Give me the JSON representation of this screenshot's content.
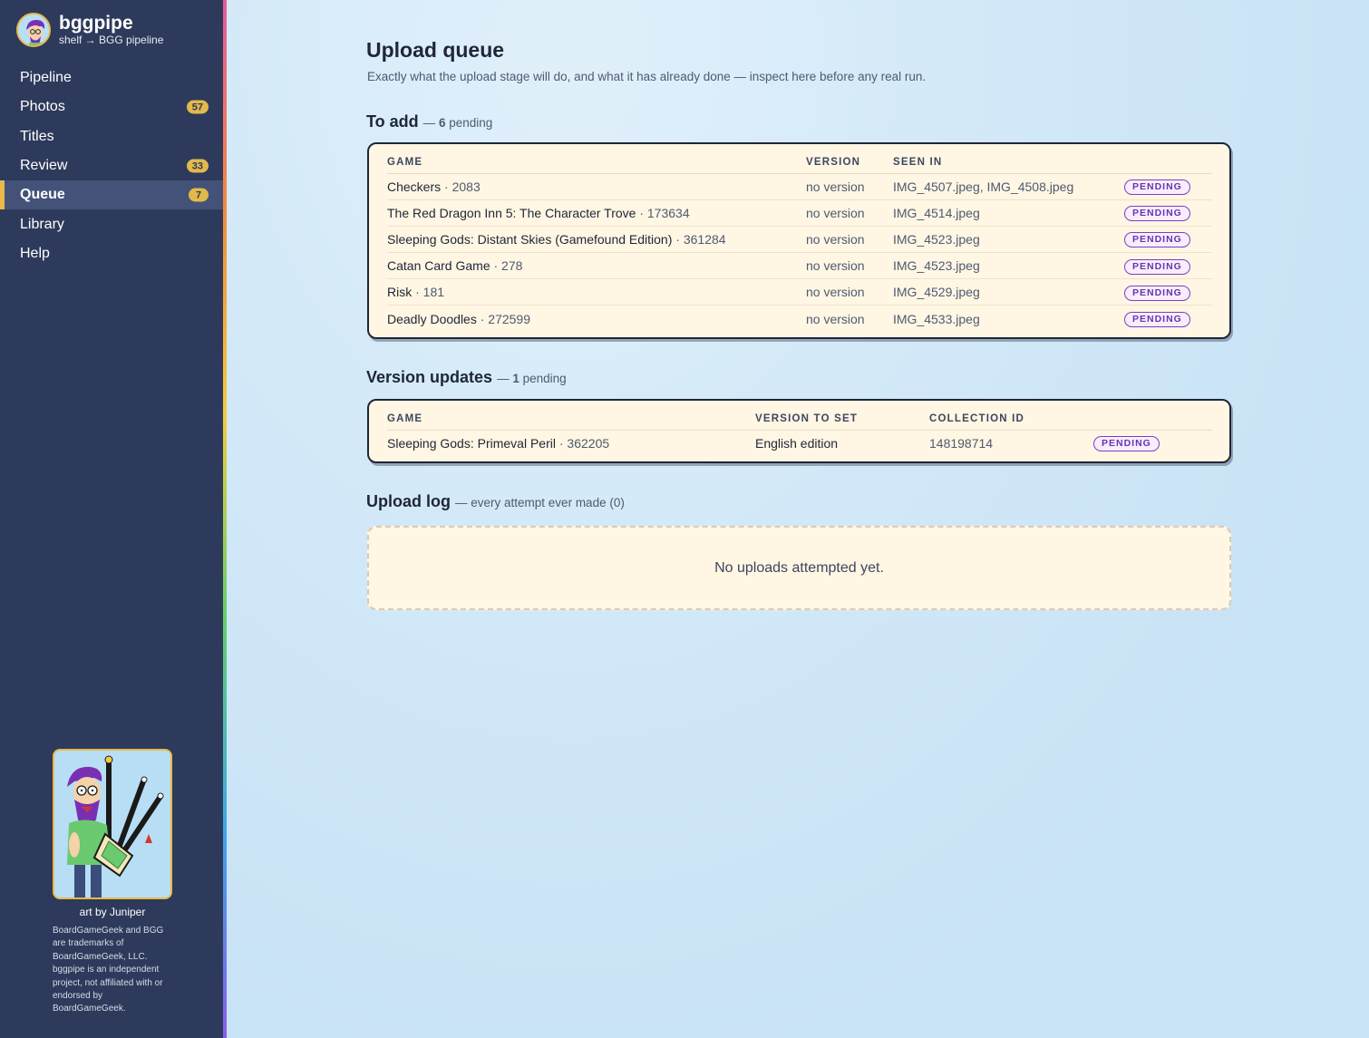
{
  "app": {
    "name": "bggpipe",
    "tagline": "shelf → BGG pipeline"
  },
  "nav": {
    "items": [
      {
        "label": "Pipeline",
        "badge": null
      },
      {
        "label": "Photos",
        "badge": "57"
      },
      {
        "label": "Titles",
        "badge": null
      },
      {
        "label": "Review",
        "badge": "33"
      },
      {
        "label": "Queue",
        "badge": "7",
        "active": true
      },
      {
        "label": "Library",
        "badge": null
      },
      {
        "label": "Help",
        "badge": null
      }
    ]
  },
  "sidebar_footer": {
    "art_credit": "art by Juniper",
    "disclaimer": "BoardGameGeek and BGG are trademarks of BoardGameGeek, LLC. bggpipe is an independent project, not affiliated with or endorsed by BoardGameGeek."
  },
  "page": {
    "title": "Upload queue",
    "subtitle": "Exactly what the upload stage will do, and what it has already done — inspect here before any real run."
  },
  "to_add": {
    "title": "To add",
    "dash": "—",
    "count": "6",
    "count_suffix": "pending",
    "columns": [
      "GAME",
      "VERSION",
      "SEEN IN",
      ""
    ],
    "rows": [
      {
        "game": "Checkers",
        "id": "· 2083",
        "version": "no version",
        "seen_in": "IMG_4507.jpeg, IMG_4508.jpeg",
        "status": "PENDING"
      },
      {
        "game": "The Red Dragon Inn 5: The Character Trove",
        "id": "· 173634",
        "version": "no version",
        "seen_in": "IMG_4514.jpeg",
        "status": "PENDING"
      },
      {
        "game": "Sleeping Gods: Distant Skies (Gamefound Edition)",
        "id": "· 361284",
        "version": "no version",
        "seen_in": "IMG_4523.jpeg",
        "status": "PENDING"
      },
      {
        "game": "Catan Card Game",
        "id": "· 278",
        "version": "no version",
        "seen_in": "IMG_4523.jpeg",
        "status": "PENDING"
      },
      {
        "game": "Risk",
        "id": "· 181",
        "version": "no version",
        "seen_in": "IMG_4529.jpeg",
        "status": "PENDING"
      },
      {
        "game": "Deadly Doodles",
        "id": "· 272599",
        "version": "no version",
        "seen_in": "IMG_4533.jpeg",
        "status": "PENDING"
      }
    ]
  },
  "version_updates": {
    "title": "Version updates",
    "dash": "—",
    "count": "1",
    "count_suffix": "pending",
    "columns": [
      "GAME",
      "VERSION TO SET",
      "COLLECTION ID",
      ""
    ],
    "rows": [
      {
        "game": "Sleeping Gods: Primeval Peril",
        "id": "· 362205",
        "version": "English edition",
        "collection_id": "148198714",
        "status": "PENDING"
      }
    ]
  },
  "upload_log": {
    "title": "Upload log",
    "meta": "— every attempt ever made (0)",
    "empty_text": "No uploads attempted yet."
  },
  "colors": {
    "sidebar": "#2d3a5b",
    "accent": "#e9b949",
    "card": "#fff6e3",
    "pill": "#7b3fc2"
  }
}
